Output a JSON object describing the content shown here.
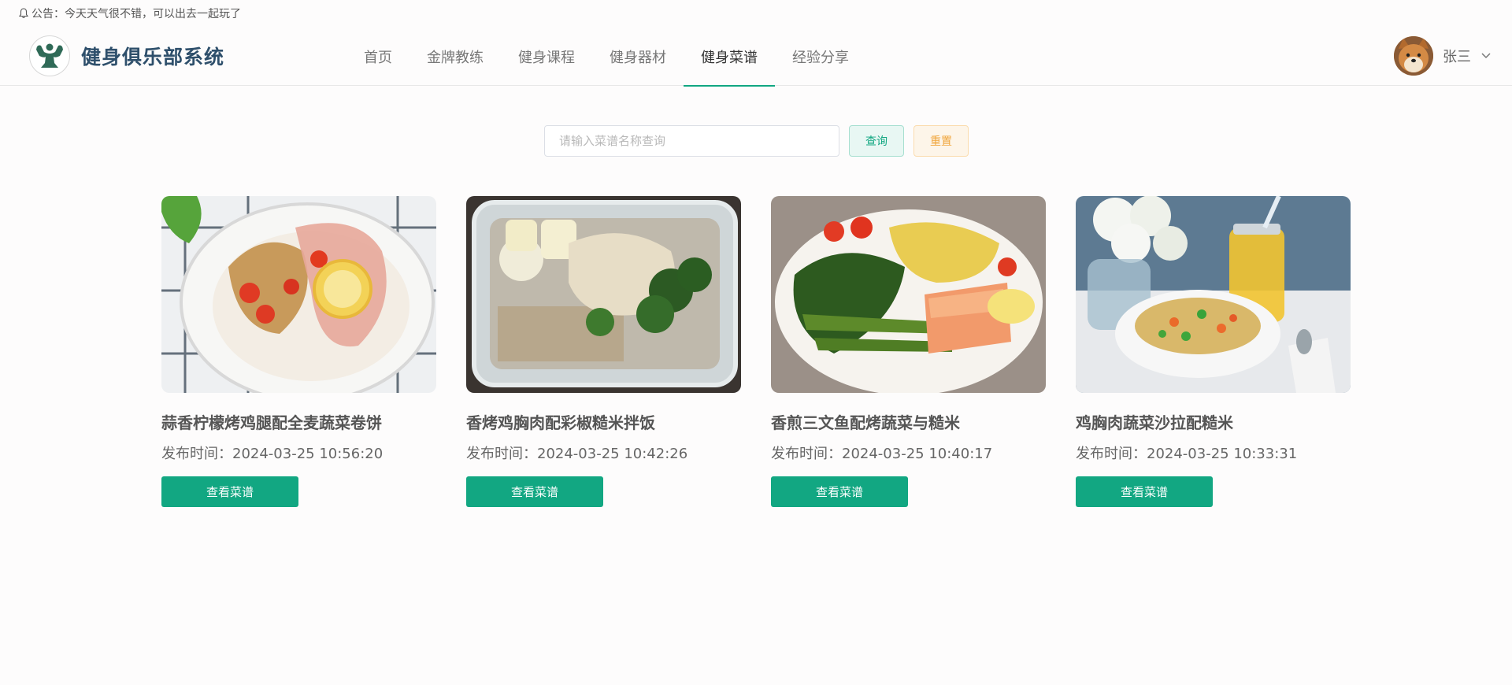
{
  "notice": {
    "text": "公告：今天天气很不错，可以出去一起玩了",
    "icon": "bell-icon"
  },
  "header": {
    "site_title": "健身俱乐部系统",
    "logo_icon": "muscle-logo-icon",
    "nav": [
      {
        "label": "首页",
        "active": false
      },
      {
        "label": "金牌教练",
        "active": false
      },
      {
        "label": "健身课程",
        "active": false
      },
      {
        "label": "健身器材",
        "active": false
      },
      {
        "label": "健身菜谱",
        "active": true
      },
      {
        "label": "经验分享",
        "active": false
      }
    ],
    "user": {
      "name": "张三",
      "avatar_icon": "shiba-dog-avatar",
      "dropdown_icon": "chevron-down-icon"
    }
  },
  "search": {
    "placeholder": "请输入菜谱名称查询",
    "value": "",
    "query_label": "查询",
    "reset_label": "重置"
  },
  "recipes": [
    {
      "title": "蒜香柠檬烤鸡腿配全麦蔬菜卷饼",
      "time": "发布时间：2024-03-25 10:56:20",
      "button": "查看菜谱"
    },
    {
      "title": "香烤鸡胸肉配彩椒糙米拌饭",
      "time": "发布时间：2024-03-25 10:42:26",
      "button": "查看菜谱"
    },
    {
      "title": "香煎三文鱼配烤蔬菜与糙米",
      "time": "发布时间：2024-03-25 10:40:17",
      "button": "查看菜谱"
    },
    {
      "title": "鸡胸肉蔬菜沙拉配糙米",
      "time": "发布时间：2024-03-25 10:33:31",
      "button": "查看菜谱"
    }
  ],
  "colors": {
    "accent": "#12a782",
    "title": "#2e4f6b",
    "reset": "#f0a53b"
  }
}
